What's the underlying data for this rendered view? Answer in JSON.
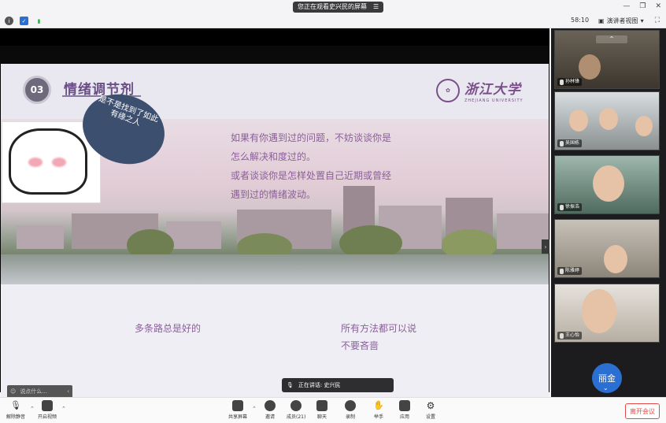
{
  "share_banner": {
    "text": "您正在观看史兴民的屏幕",
    "menu_icon": "menu-icon"
  },
  "window": {
    "min": "—",
    "restore": "❐",
    "close": "✕"
  },
  "toolbar": {
    "timer": "58:10",
    "presenter_view": "演讲者视图"
  },
  "slide": {
    "number": "03",
    "title": "情绪调节剂",
    "logo_cn": "浙江大学",
    "logo_en": "ZHEJIANG UNIVERSITY",
    "bubble": "是不是找到了如此有缘之人",
    "main_text": [
      "如果有你遇到过的问题，不妨谈谈你是",
      "怎么解决和度过的。",
      "或者谈谈你是怎样处置自己近期或曾经",
      "遇到过的情绪波动。"
    ],
    "bottom_left": "多条路总是好的",
    "bottom_right": [
      "所有方法都可以说",
      "不要吝啬"
    ]
  },
  "chat_input_placeholder": "说点什么...",
  "speaking": "正在讲话: 史兴民",
  "participants": [
    {
      "name": "孙林锋"
    },
    {
      "name": "吴国栋"
    },
    {
      "name": "徐振浩"
    },
    {
      "name": "陈雅婷"
    },
    {
      "name": "王心怡"
    }
  ],
  "avatar_label": "丽金",
  "bottom_toolbar": {
    "mute": "解除静音",
    "video": "开启视频",
    "share": "共享屏幕",
    "invite": "邀请",
    "members": "成员(21)",
    "chat": "聊天",
    "record": "录制",
    "raise": "举手",
    "apps": "应用",
    "settings": "设置",
    "leave": "离开会议"
  }
}
